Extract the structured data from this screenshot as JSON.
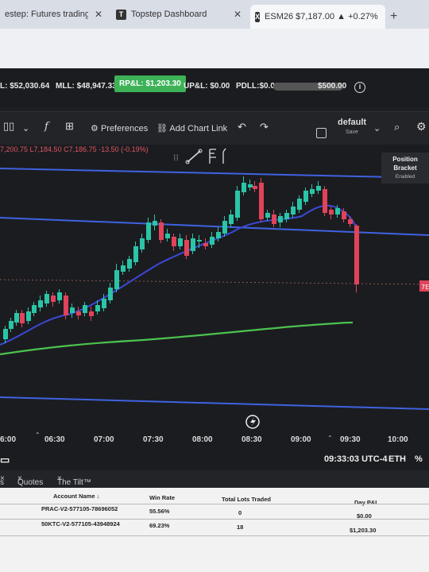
{
  "browser": {
    "tabs": [
      {
        "label": "estep: Futures trading, funde",
        "favicon": ""
      },
      {
        "label": "Topstep Dashboard",
        "favicon": "T"
      },
      {
        "label": "ESM26 $7,187.00 ▲ +0.27%",
        "favicon": "X"
      }
    ],
    "new_tab": "+"
  },
  "account_stats": {
    "item1": "L: $52,030.64",
    "mll": "MLL: $48,947.33",
    "rpl": "RP&L: $1,203.30",
    "upl": "UP&L: $0.00",
    "pdll": "PDLL:$0.00",
    "pdll_limit": "$500.00"
  },
  "toolbar": {
    "preferences": "Preferences",
    "add_chart_link": "Add Chart Link",
    "layout_name": "default",
    "layout_save": "Save"
  },
  "chart": {
    "ohlc_text": "7,200.75  L7,184.50  C7,186.75  -13.50 (-0.19%)",
    "position_bracket": {
      "title": "Position Bracket",
      "state": "Enabled"
    },
    "price_flag": "7E",
    "time_ticks": [
      "6:00",
      "06:30",
      "07:00",
      "07:30",
      "08:00",
      "08:30",
      "09:00",
      "09:30",
      "10:00"
    ],
    "colors": {
      "up": "#2ac4a6",
      "down": "#e0435a",
      "ema_fast": "#3b48d6",
      "ema_slow": "#4cc34e",
      "level": "#3f62e0"
    }
  },
  "status": {
    "clock": "09:33:03 UTC-4",
    "session": "ETH",
    "percent": "%"
  },
  "panel_tabs": [
    "s",
    "Quotes",
    "The Tilt™"
  ],
  "accounts_table": {
    "headers": {
      "name": "Account Name",
      "win_rate": "Win Rate",
      "lots": "Total Lots Traded",
      "pnl": "Day P&L"
    },
    "rows": [
      {
        "name": "PRAC-V2-577105-78696052",
        "win_rate": "55.56%",
        "lots": "0",
        "pnl": "$0.00"
      },
      {
        "name": "50KTC-V2-577105-43948924",
        "win_rate": "69.23%",
        "lots": "18",
        "pnl": "$1,203.30"
      }
    ]
  }
}
